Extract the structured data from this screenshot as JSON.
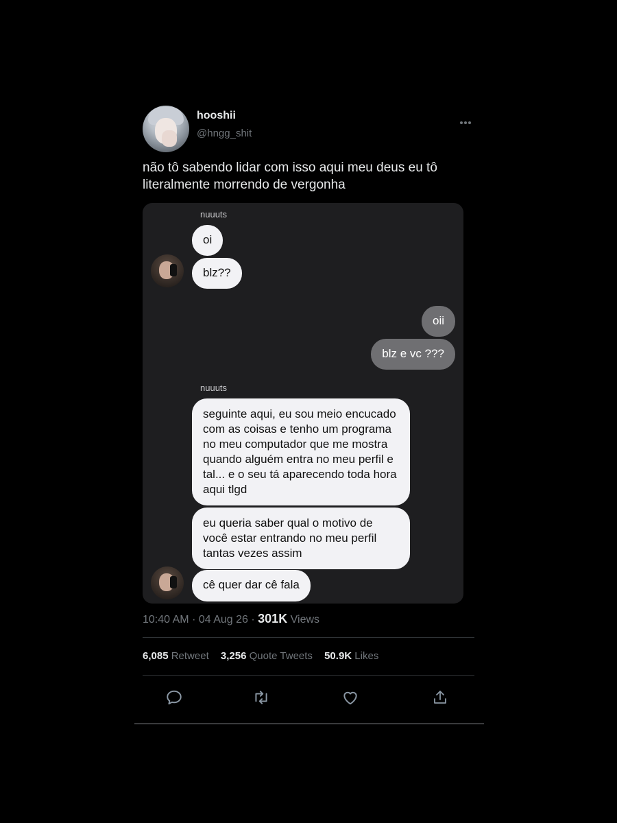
{
  "user": {
    "display_name": "hooshii",
    "handle": "@hngg_shit"
  },
  "tweet": {
    "text": "não tô sabendo lidar com isso aqui meu deus eu tô literalmente morrendo de vergonha"
  },
  "chat": {
    "sender_name_1": "nuuuts",
    "sender_name_2": "nuuuts",
    "messages": [
      {
        "from": "nuuuts",
        "text": "oi"
      },
      {
        "from": "nuuuts",
        "text": "blz??"
      },
      {
        "from": "me",
        "text": "oii"
      },
      {
        "from": "me",
        "text": "blz e vc ???"
      },
      {
        "from": "nuuuts",
        "text": "seguinte aqui, eu sou meio encucado com as coisas e tenho um programa no meu computador que me mostra quando alguém entra no meu perfil e tal... e o seu tá aparecendo toda hora aqui tlgd"
      },
      {
        "from": "nuuuts",
        "text": "eu queria saber qual o motivo de você estar entrando no meu perfil tantas vezes assim"
      },
      {
        "from": "nuuuts",
        "text": "cê quer dar cê fala"
      }
    ]
  },
  "meta": {
    "time": "10:40 AM",
    "sep1": "·",
    "date": "04 Aug 26",
    "sep2": "·",
    "views_count": "301K",
    "views_label": "Views"
  },
  "stats": {
    "retweets_count": "6,085",
    "retweets_label": "Retweet",
    "quotes_count": "3,256",
    "quotes_label": "Quote Tweets",
    "likes_count": "50.9K",
    "likes_label": "Likes"
  },
  "icons": {
    "more": "more-horizontal-icon",
    "reply": "reply-icon",
    "retweet": "retweet-icon",
    "like": "heart-icon",
    "share": "share-icon"
  },
  "colors": {
    "background": "#000000",
    "chat_background": "#1e1e20",
    "incoming_bubble": "#f2f2f5",
    "outgoing_bubble": "#6f6f72",
    "secondary_text": "#71767b"
  }
}
